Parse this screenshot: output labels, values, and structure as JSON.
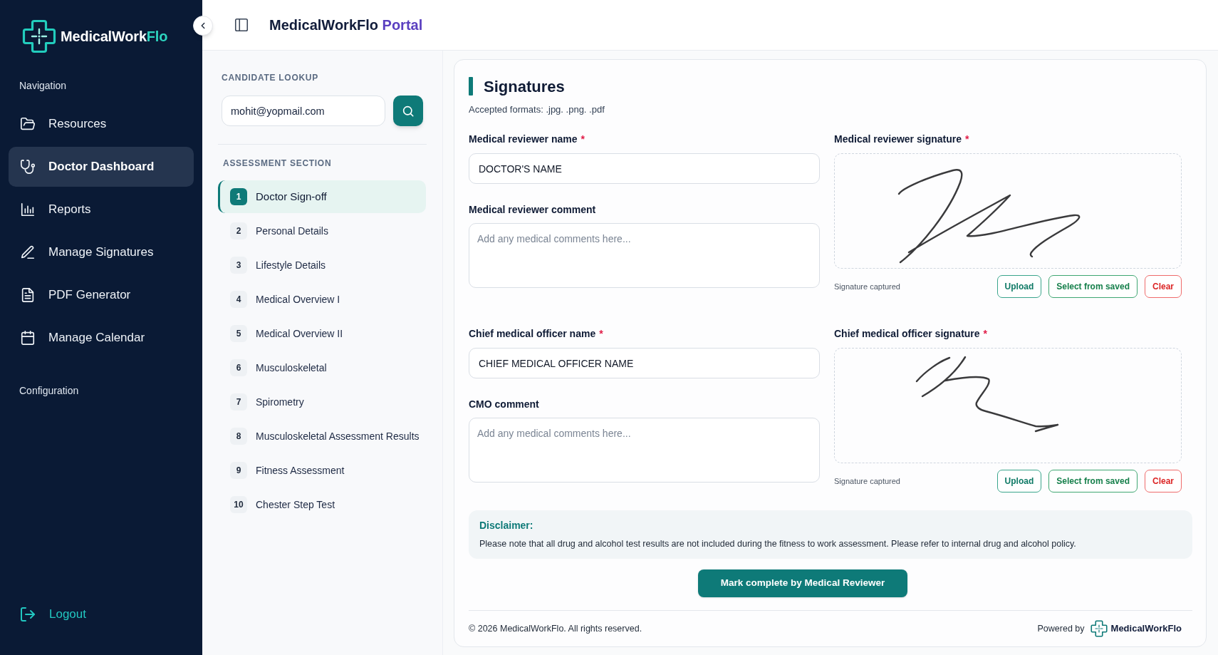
{
  "sidebar": {
    "brand": "MedicalWork",
    "brand_accent": "Flo",
    "sections": [
      {
        "heading": "Navigation",
        "items": [
          {
            "label": "Resources",
            "selected": false
          },
          {
            "label": "Doctor Dashboard",
            "selected": true
          },
          {
            "label": "Reports",
            "selected": false
          },
          {
            "label": "Manage Signatures",
            "selected": false
          },
          {
            "label": "PDF Generator",
            "selected": false
          },
          {
            "label": "Manage Calendar",
            "selected": false
          }
        ]
      },
      {
        "heading": "Configuration"
      }
    ],
    "logout": "Logout"
  },
  "header": {
    "title": "MedicalWorkFlo",
    "title_accent": "Portal"
  },
  "candidate_lookup": {
    "heading": "CANDIDATE LOOKUP",
    "value": "mohit@yopmail.com"
  },
  "assessment": {
    "heading": "ASSESSMENT SECTION",
    "items": [
      {
        "number": "1",
        "label": "Doctor Sign-off",
        "selected": true
      },
      {
        "number": "2",
        "label": "Personal Details",
        "selected": false
      },
      {
        "number": "3",
        "label": "Lifestyle Details",
        "selected": false
      },
      {
        "number": "4",
        "label": "Medical Overview I",
        "selected": false
      },
      {
        "number": "5",
        "label": "Medical Overview II",
        "selected": false
      },
      {
        "number": "6",
        "label": "Musculoskeletal",
        "selected": false
      },
      {
        "number": "7",
        "label": "Spirometry",
        "selected": false
      },
      {
        "number": "8",
        "label": "Musculoskeletal Assessment Results",
        "selected": false
      },
      {
        "number": "9",
        "label": "Fitness Assessment",
        "selected": false
      },
      {
        "number": "10",
        "label": "Chester Step Test",
        "selected": false
      }
    ]
  },
  "signatures": {
    "title": "Signatures",
    "subtitle": "Accepted formats: .jpg. .png. .pdf",
    "blocks": [
      {
        "name_field": {
          "label": "Medical reviewer name",
          "required_mark": "*",
          "value": "DOCTOR'S NAME"
        },
        "comment_field": {
          "label": "Medical reviewer comment",
          "placeholder": "Add any medical comments here..."
        },
        "signature": {
          "label": "Medical reviewer signature",
          "required_mark": "*",
          "status": "Signature captured",
          "buttons": [
            {
              "label": "Upload",
              "kind": "primary"
            },
            {
              "label": "Select from saved",
              "kind": "secondary"
            },
            {
              "label": "Clear",
              "kind": "danger"
            }
          ]
        }
      },
      {
        "name_field": {
          "label": "Chief medical officer name",
          "required_mark": "*",
          "value": "CHIEF MEDICAL OFFICER NAME"
        },
        "comment_field": {
          "label": "CMO comment",
          "placeholder": "Add any medical comments here..."
        },
        "signature": {
          "label": "Chief medical officer signature",
          "required_mark": "*",
          "status": "Signature captured",
          "buttons": [
            {
              "label": "Upload",
              "kind": "primary"
            },
            {
              "label": "Select from saved",
              "kind": "secondary"
            },
            {
              "label": "Clear",
              "kind": "danger"
            }
          ]
        }
      }
    ]
  },
  "disclaimer": {
    "title": "Disclaimer:",
    "text": "Please note that all drug and alcohol test results are not included during the fitness to work assessment. Please refer to internal drug and alcohol policy."
  },
  "submit_button": "Mark complete by Medical Reviewer",
  "footer": {
    "copyright": "© 2026 MedicalWorkFlo. All rights reserved.",
    "powered_by": "Powered by",
    "brand": "MedicalWorkFlo"
  }
}
